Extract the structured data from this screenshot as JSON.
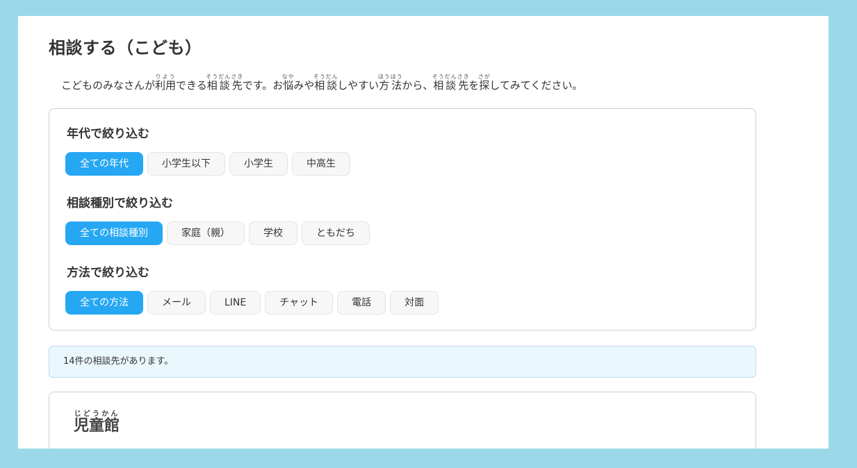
{
  "page": {
    "title": "相談する（こども）"
  },
  "intro": {
    "t1": "こどものみなさんが",
    "r1": {
      "base": "利用",
      "ruby": "りよう"
    },
    "t2": "できる",
    "r2": {
      "base": "相談先",
      "ruby": "そうだんさき"
    },
    "t3": "です。お",
    "r3": {
      "base": "悩",
      "ruby": "なや"
    },
    "t4": "みや",
    "r4": {
      "base": "相談",
      "ruby": "そうだん"
    },
    "t5": "しやすい",
    "r5": {
      "base": "方法",
      "ruby": "ほうほう"
    },
    "t6": "から、",
    "r6": {
      "base": "相談先",
      "ruby": "そうだんさき"
    },
    "t7": "を",
    "r7": {
      "base": "探",
      "ruby": "さが"
    },
    "t8": "してみてください。"
  },
  "filters": {
    "age": {
      "heading": "年代で絞り込む",
      "options": [
        "全ての年代",
        "小学生以下",
        "小学生",
        "中高生"
      ],
      "selected": "全ての年代"
    },
    "type": {
      "heading": "相談種別で絞り込む",
      "options": [
        "全ての相談種別",
        "家庭（親）",
        "学校",
        "ともだち"
      ],
      "selected": "全ての相談種別"
    },
    "method": {
      "heading": "方法で絞り込む",
      "options": [
        "全ての方法",
        "メール",
        "LINE",
        "チャット",
        "電話",
        "対面"
      ],
      "selected": "全ての方法"
    }
  },
  "results": {
    "count_text": "14件の相談先があります。"
  },
  "cards": [
    {
      "title": "児童館",
      "title_ruby": "じどうかん"
    }
  ],
  "colors": {
    "accent": "#26a7f3",
    "background": "#9cd9e8",
    "result_bg": "#eaf7fd"
  }
}
